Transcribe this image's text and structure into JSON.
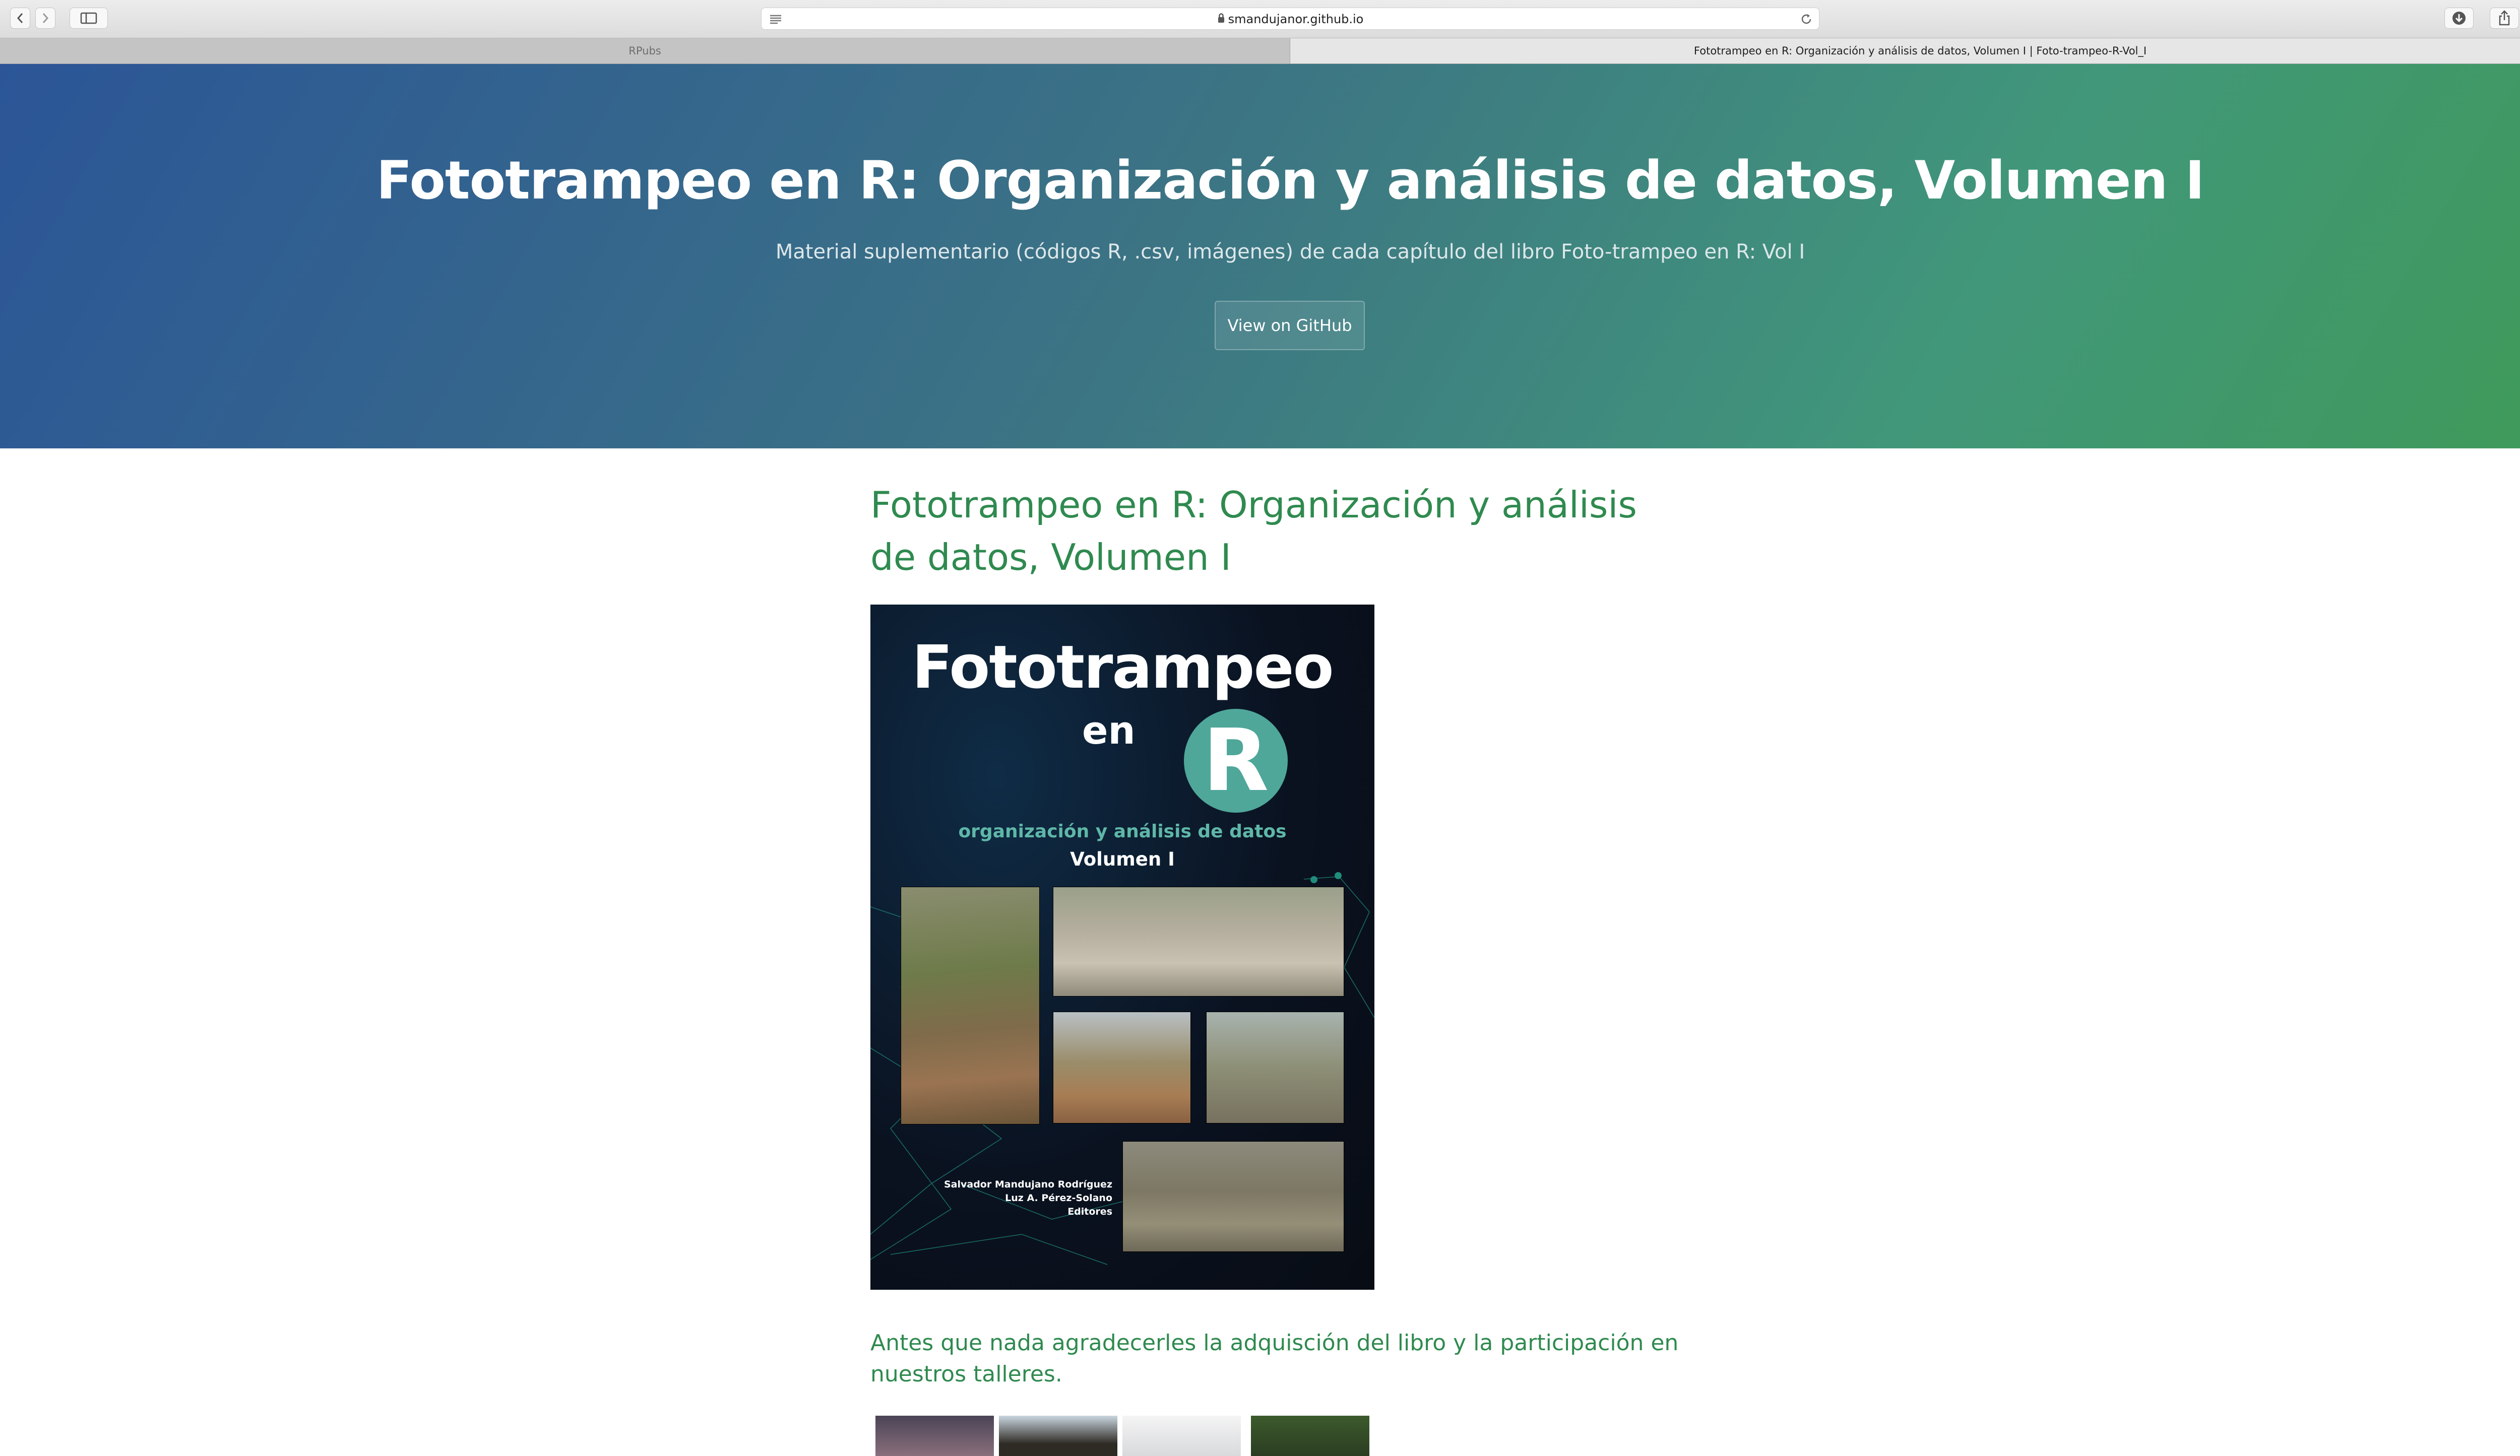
{
  "browser": {
    "url": "smandujanor.github.io",
    "tabs": [
      {
        "label": "RPubs",
        "active": false
      },
      {
        "label": "Fototrampeo en R: Organización y análisis de datos, Volumen I | Foto-trampeo-R-Vol_I",
        "active": true
      }
    ]
  },
  "header": {
    "title": "Fototrampeo en R: Organización y análisis de datos, Volumen I",
    "tagline": "Material suplementario (códigos R, .csv, imágenes) de cada capítulo del libro Foto-trampeo en R: Vol I",
    "github_button": "View on GitHub"
  },
  "content": {
    "heading": "Fototrampeo en R: Organización y análisis de datos, Volumen I",
    "intro": "Antes que nada agradecerles la adquisción del libro y la participación en nuestros talleres."
  },
  "cover": {
    "title": "Fototrampeo",
    "en": "en",
    "r": "R",
    "subtitle": "organización y análisis de datos",
    "volume": "Volumen I",
    "editors": [
      "Salvador Mandujano Rodríguez",
      "Luz A. Pérez-Solano",
      "Editores"
    ]
  },
  "colors": {
    "header_gradient": [
      "#2b5597",
      "#3f9a58"
    ],
    "content_green": "#2f8a4f",
    "r_logo_teal": "#4fa79a"
  }
}
